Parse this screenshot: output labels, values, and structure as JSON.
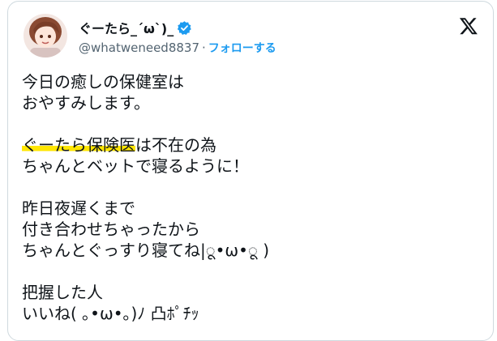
{
  "author": {
    "display_name": "ぐーたら_´ω`)_",
    "handle": "@whatweneed8837",
    "separator": "·",
    "follow_label": "フォローする",
    "verified": true
  },
  "colors": {
    "verified_blue": "#1d9bf0",
    "link_blue": "#1d9bf0",
    "highlight_yellow": "#ffe600",
    "text": "#0f1419",
    "muted": "#536471"
  },
  "tweet": {
    "line1": "今日の癒しの保健室は",
    "line2": "おやすみします。",
    "line3_highlight": "ぐーたら保険医",
    "line3_rest": "は不在の為",
    "line4": "ちゃんとベットで寝るように！",
    "line5": "昨日夜遅くまで",
    "line6": "付き合わせちゃったから",
    "line7": "ちゃんとぐっすり寝てね|ू•ω•ू )",
    "line8": "把握した人",
    "line9": "いいね( ｡•ω•｡)ﾉ 凸ﾎﾟﾁｯ"
  },
  "icons": {
    "verified": "verified-badge-icon",
    "brand": "x-logo-icon"
  }
}
